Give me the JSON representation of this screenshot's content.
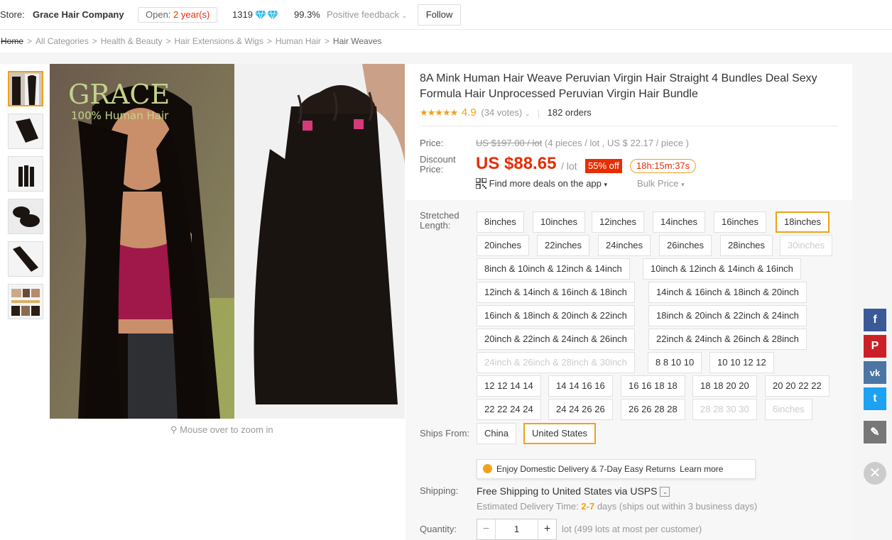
{
  "store": {
    "label": "Store:",
    "name": "Grace Hair Company",
    "open_label": "Open:",
    "open_years": "2 year(s)",
    "score": "1319",
    "feedback_pct": "99.3%",
    "feedback_label": "Positive feedback",
    "follow_label": "Follow"
  },
  "breadcrumb": [
    "Home",
    "All Categories",
    "Health & Beauty",
    "Hair Extensions & Wigs",
    "Human Hair",
    "Hair Weaves"
  ],
  "gallery": {
    "logo_text": "GRACE",
    "logo_sub": "100% Human Hair",
    "zoom_hint": "Mouse over to zoom in"
  },
  "product": {
    "title": "8A Mink Human Hair Weave Peruvian Virgin Hair Straight 4 Bundles Deal Sexy Formula Hair Unprocessed Peruvian Virgin Hair Bundle",
    "stars": "★★★★★",
    "rating": "4.9",
    "votes": "(34 votes)",
    "orders": "182 orders",
    "price_label": "Price:",
    "original_price": "US $197.00 / lot",
    "price_note": "(4 pieces / lot , US $ 22.17 / piece )",
    "discount_label_1": "Discount",
    "discount_label_2": "Price:",
    "discount_price": "US $88.65",
    "per_lot": "/ lot",
    "off": "55% off",
    "timer": "18h:15m:37s",
    "deals_label": "Find more deals on the app",
    "bulk_label": "Bulk Price"
  },
  "options": {
    "length_label_1": "Stretched",
    "length_label_2": "Length:",
    "lengths": [
      "8inches",
      "10inches",
      "12inches",
      "14inches",
      "16inches",
      "18inches",
      "20inches",
      "22inches",
      "24inches",
      "26inches",
      "28inches",
      "30inches",
      "8inch & 10inch & 12inch & 14inch",
      "10inch & 12inch & 14inch & 16inch",
      "12inch & 14inch & 16inch & 18inch",
      "14inch & 16inch & 18inch & 20inch",
      "16inch & 18inch & 20inch & 22inch",
      "18inch & 20inch & 22inch & 24inch",
      "20inch & 22inch & 24inch & 26inch",
      "22inch & 24inch & 26inch & 28inch",
      "24inch & 26inch & 28inch & 30inch",
      "8 8 10 10",
      "10 10 12 12",
      "12 12 14 14",
      "14 14 16 16",
      "16 16 18 18",
      "18 18 20 20",
      "20 20 22 22",
      "22 22 24 24",
      "24 24 26 26",
      "26 26 28 28",
      "28 28 30 30",
      "6inches"
    ],
    "selected_length": "18inches",
    "ships_from_label": "Ships From:",
    "ships_from": [
      "China",
      "United States"
    ],
    "selected_ships_from": "United States",
    "tip_text": "Enjoy Domestic Delivery & 7-Day Easy Returns",
    "tip_link": "Learn more"
  },
  "shipping": {
    "label": "Shipping:",
    "text": "Free Shipping to United States via USPS",
    "est_prefix": "Estimated Delivery Time:",
    "est_days": "2-7",
    "est_suffix": "days (ships out within 3 business days)"
  },
  "quantity": {
    "label": "Quantity:",
    "minus": "−",
    "value": "1",
    "plus": "+",
    "note": "lot (499 lots at most per customer)"
  },
  "social": {
    "facebook": "f",
    "pinterest": "P",
    "vk": "vk",
    "twitter": "t",
    "edit": "✎",
    "close": "✕",
    "colors": {
      "facebook": "#3b5998",
      "pinterest": "#cb2027",
      "vk": "#4c75a3",
      "twitter": "#1da1f2",
      "edit": "#777777"
    }
  },
  "colors": {
    "accent": "#f0a11b",
    "price": "#e62e04"
  }
}
